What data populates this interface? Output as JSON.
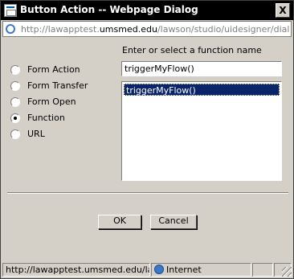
{
  "window": {
    "title": "Button Action -- Webpage Dialog",
    "close_label": "X"
  },
  "address": {
    "url_prefix": "http://lawapptest.",
    "url_host": "umsmed.edu",
    "url_suffix": "/lawson/studio/uidesigner/dialogs/btn"
  },
  "options": {
    "items": [
      {
        "label": "Form Action",
        "selected": false
      },
      {
        "label": "Form Transfer",
        "selected": false
      },
      {
        "label": "Form Open",
        "selected": false
      },
      {
        "label": "Function",
        "selected": true
      },
      {
        "label": "URL",
        "selected": false
      }
    ]
  },
  "function_panel": {
    "prompt": "Enter or select a function name",
    "value": "triggerMyFlow()",
    "list": [
      "triggerMyFlow()"
    ]
  },
  "buttons": {
    "ok": "OK",
    "cancel": "Cancel"
  },
  "statusbar": {
    "url": "http://lawapptest.umsmed.edu/lawso",
    "zone": "Internet"
  },
  "colors": {
    "selection": "#0a246a",
    "face": "#d4d0c8"
  }
}
